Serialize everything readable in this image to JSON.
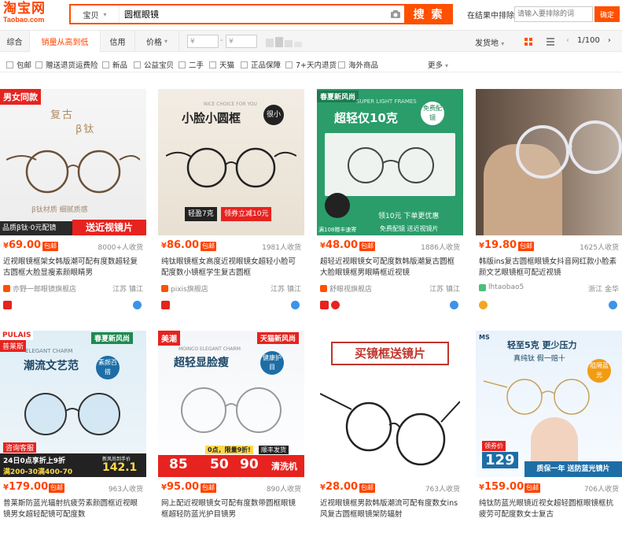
{
  "header": {
    "logo_cn": "淘宝网",
    "logo_en": "Taobao.com",
    "search_type": "宝贝",
    "search_query": "圆框眼镜",
    "search_button": "搜 索",
    "within_label": "在结果中排除",
    "within_placeholder": "请输入要排除的词",
    "within_button": "确定"
  },
  "sort": {
    "tabs": [
      "综合",
      "销量从高到低",
      "信用",
      "价格"
    ],
    "price_min_placeholder": "¥",
    "price_max_placeholder": "¥",
    "ship_from": "发货地",
    "page": "1/100"
  },
  "filters": [
    "包邮",
    "赠送退货运费险",
    "新品",
    "公益宝贝",
    "二手",
    "天猫",
    "正品保障",
    "7+天内退货",
    "海外商品"
  ],
  "filters_more": "更多",
  "products": [
    {
      "price": "69.00",
      "sales": "8000+人收货",
      "title": "近视眼镜框架女韩版潮可配有度数超轻复古圆框大脸显瘦素颜眼睛男",
      "shop": "亦野一郎眼镜旗舰店",
      "location": "江苏 镇江",
      "img_tag": "男女同款",
      "img_text1": "复古",
      "img_text2": "β钛",
      "img_banner": "品质β钛·0元配镜",
      "img_banner2": "送近视镜片",
      "img_caption": "β钛材质 细腻质感"
    },
    {
      "price": "86.00",
      "sales": "1981人收货",
      "title": "纯钛眼镜框女高度近视眼镜女超轻小脸可配度数小镜框学生复古圆框",
      "shop": "pixis旗舰店",
      "location": "江苏 镇江",
      "img_top": "NICE CHOICE FOR YOU",
      "img_text1": "小脸小圆框",
      "img_circle": "很小",
      "img_banner": "轻盈7克",
      "img_banner2": "领券立减10元"
    },
    {
      "price": "48.00",
      "sales": "1886人收货",
      "title": "超轻近视眼镜女可配度数韩版潮复古圆框大脸眼镜框男眼睛框近视镜",
      "shop": "舒眼视旗舰店",
      "location": "江苏 镇江",
      "img_tag": "春夏新风尚",
      "img_top": "SUPER LIGHT FRAMES",
      "img_text1": "超轻仅10克",
      "img_circle": "免费配镜",
      "img_banner": "领10元 下单更优惠",
      "img_banner2": "免费配镜 送近视镜片",
      "img_small": "满108赠丰速寄"
    },
    {
      "price": "19.80",
      "sales": "1625人收货",
      "title": "韩版ins复古圆框眼镜女抖音网红款小脸素颜文艺眼镜框可配近视镜",
      "shop": "lhtaobao5",
      "location": "浙江 金华"
    },
    {
      "price": "179.00",
      "sales": "963人收货",
      "title": "普莱斯防蓝光辐射抗疲劳素颜圆框近视眼镜男女超轻配镜可配度数",
      "shop": "普莱斯眼镜旗舰店",
      "location": "江苏 镇江",
      "img_brand": "PULAIS",
      "img_brand_cn": "普莱斯",
      "img_tag": "春夏新风尚",
      "img_top": "ELEGANT CHARM",
      "img_text1": "潮流文艺范",
      "img_circle": "素颜百搭",
      "img_banner": "24日0点享折上9折",
      "img_banner2": "满200-30满400-70",
      "img_small": "咨询客服",
      "img_price": "142.1",
      "img_price_label": "新风尚到手价"
    },
    {
      "price": "95.00",
      "sales": "890人收货",
      "title": "网上配近视眼镜女可配有度数带圆框眼镜框超轻防蓝光护目镜男",
      "shop": "美潮眼镜旗舰店",
      "location": "江苏 镇江",
      "img_brand": "美潮",
      "img_tag": "天猫新风尚",
      "img_top": "MOINCO ELEGANT CHARM",
      "img_text1": "超轻显脸瘦",
      "img_circle": "健康护目",
      "img_banner": "0点，限量9折!",
      "img_banner2": "顺丰发货",
      "img_coupon1": "85",
      "img_coupon2": "50",
      "img_coupon3": "90",
      "img_banner3": "清洗机"
    },
    {
      "price": "28.00",
      "sales": "763人收货",
      "title": "近视眼镜框男款韩版潮流可配有度数女ins风复古圆框眼镜架防辐射",
      "shop": "看世界眼镜店",
      "location": "江苏 镇江",
      "img_text1": "买镜框送镜片"
    },
    {
      "price": "159.00",
      "sales": "706人收货",
      "title": "纯钛防蓝光眼镜近视女超轻圆框眼镜框抗疲劳可配度数女士复古",
      "shop": "明星眼镜旗舰店",
      "location": "江苏 镇江",
      "img_brand": "MS",
      "img_text1": "轻至5克 更少压力",
      "img_text2": "真纯钛 假一赔十",
      "img_circle": "阻隔蓝光",
      "img_price": "129",
      "img_price_label": "领券价",
      "img_banner": "质保一年 送防蓝光镜片"
    }
  ],
  "colors": {
    "accent": "#ff5000",
    "price": "#ff4400"
  }
}
